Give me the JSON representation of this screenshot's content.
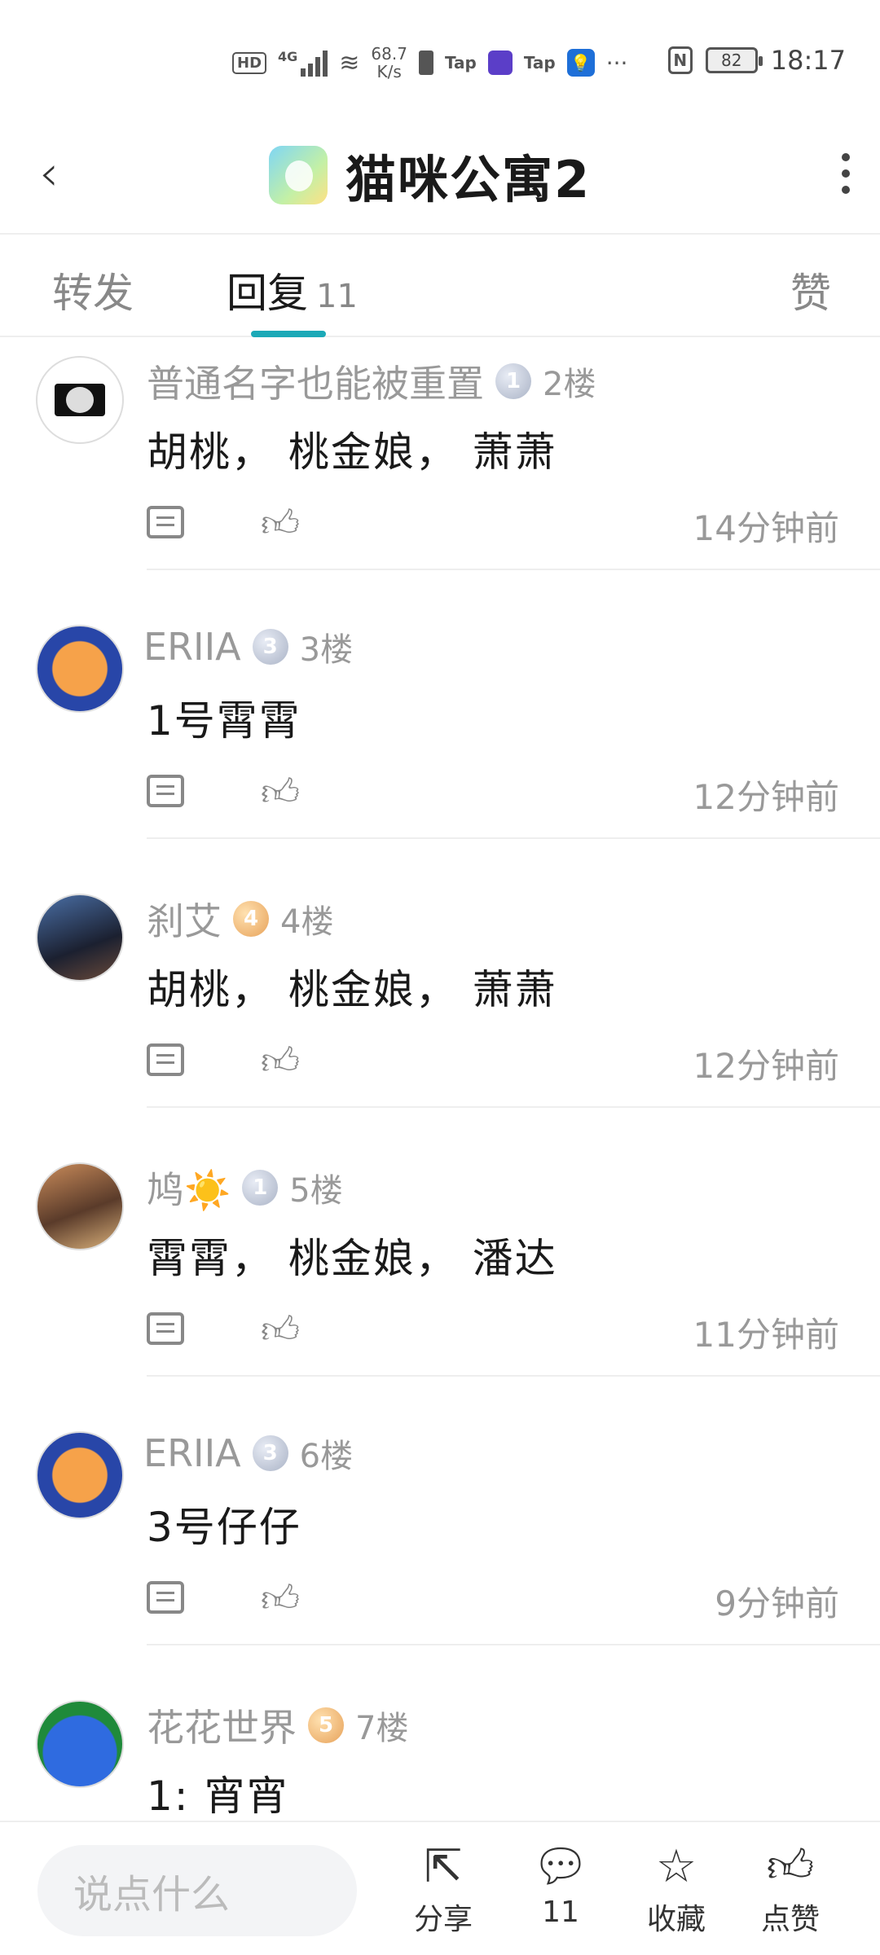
{
  "status": {
    "hd": "HD",
    "net": "4G",
    "speed_top": "68.7",
    "speed_bottom": "K/s",
    "tap1": "Tap",
    "tap2": "Tap",
    "battery": "82",
    "time": "18:17"
  },
  "header": {
    "title": "猫咪公寓2"
  },
  "tabs": {
    "forward": "转发",
    "reply": "回复",
    "reply_count": "11",
    "like": "赞"
  },
  "replies": [
    {
      "name": "普通名字也能被重置",
      "level": "1",
      "floor": "2楼",
      "content": "胡桃，  桃金娘，  萧萧",
      "time": "14分钟前"
    },
    {
      "name": "ERIIA",
      "level": "3",
      "floor": "3楼",
      "content": "1号霄霄",
      "time": "12分钟前"
    },
    {
      "name": "刹艾",
      "level": "4",
      "floor": "4楼",
      "content": "胡桃，  桃金娘，  萧萧",
      "time": "12分钟前"
    },
    {
      "name": "鸠☀️",
      "level": "1",
      "floor": "5楼",
      "content": "霄霄，  桃金娘，  潘达",
      "time": "11分钟前"
    },
    {
      "name": "ERIIA",
      "level": "3",
      "floor": "6楼",
      "content": "3号仔仔",
      "time": "9分钟前"
    },
    {
      "name": "花花世界",
      "level": "5",
      "floor": "7楼",
      "content": "1: 宵宵",
      "time": ""
    }
  ],
  "bottom": {
    "placeholder": "说点什么",
    "share": "分享",
    "comments": "11",
    "favorite": "收藏",
    "like": "点赞"
  }
}
